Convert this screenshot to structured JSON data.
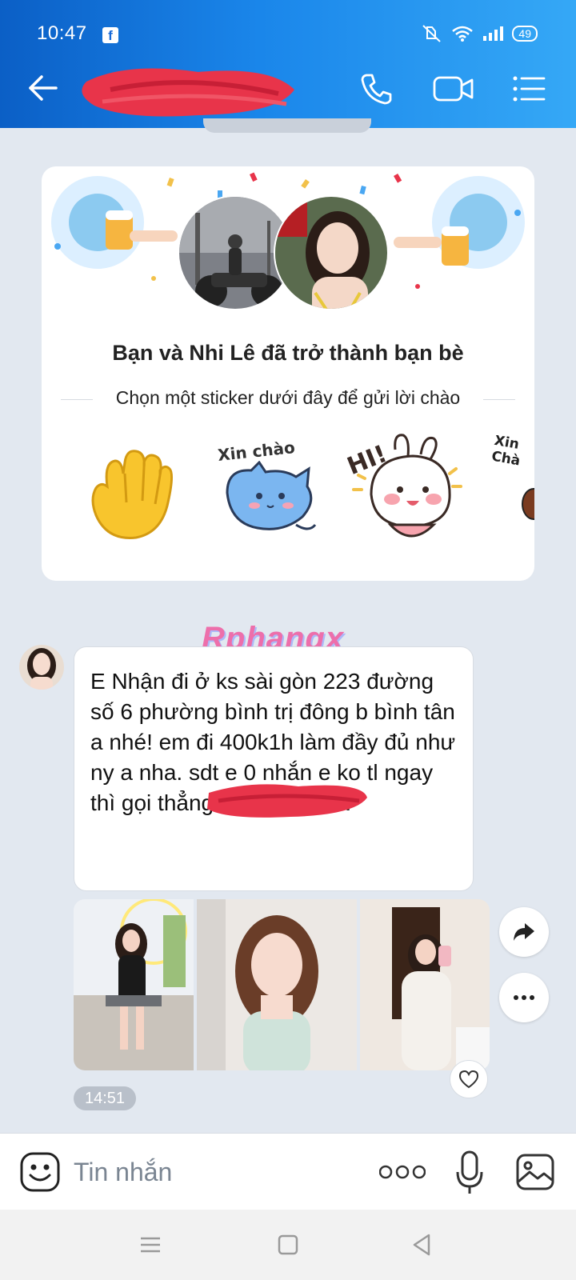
{
  "status_bar": {
    "time": "10:47",
    "fb_icon": "f",
    "battery": "49"
  },
  "friend_card": {
    "title": "Bạn và Nhi Lê đã trở thành bạn bè",
    "subtitle": "Chọn một sticker dưới đây để gửi lời chào",
    "sticker_labels": [
      "Xin chào",
      "HI!",
      "Xin Chà"
    ]
  },
  "watermark": "Rphangx",
  "message": {
    "text": "E Nhận đi ở ks sài gòn 223 đường số 6 phường bình trị đông b bình tân a nhé! em đi 400k1h làm đầy đủ như ny a nha. sdt e 0           nhắn e ko tl ngay thì gọi thẳng số đt em nha",
    "time": "14:51"
  },
  "input": {
    "placeholder": "Tin nhắn"
  },
  "colors": {
    "header_start": "#0b5fc6",
    "header_end": "#35a8f6",
    "chat_bg": "#e2e8f0",
    "redaction": "#e8344a"
  }
}
